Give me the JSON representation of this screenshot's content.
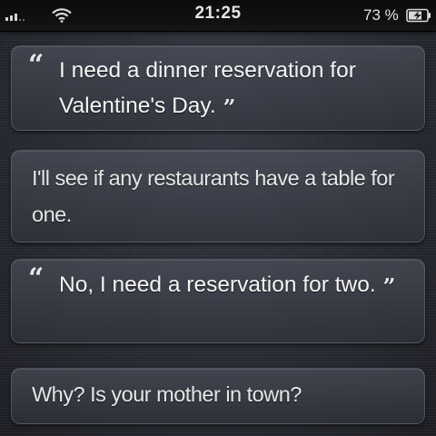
{
  "status_bar": {
    "time": "21:25",
    "battery_percent": "73 %",
    "signal_bars_filled": 3
  },
  "conversation": [
    {
      "speaker": "user",
      "text": "I need a dinner reservation for Valentine's Day.",
      "quote_icon": "open-quote-icon"
    },
    {
      "speaker": "siri",
      "text": "I'll see if any restaurants have a table for one."
    },
    {
      "speaker": "user",
      "text": "No, I need a reservation for two.",
      "quote_icon": "open-quote-icon"
    },
    {
      "speaker": "siri",
      "text": "Why? Is your mother in town?"
    }
  ],
  "quote_marks": {
    "open": "“",
    "close": "”"
  },
  "colors": {
    "background": "#2a2c34",
    "status_bar": "#0b0b0d",
    "bubble_border": "#787d8c",
    "text": "#f2f2f2"
  }
}
